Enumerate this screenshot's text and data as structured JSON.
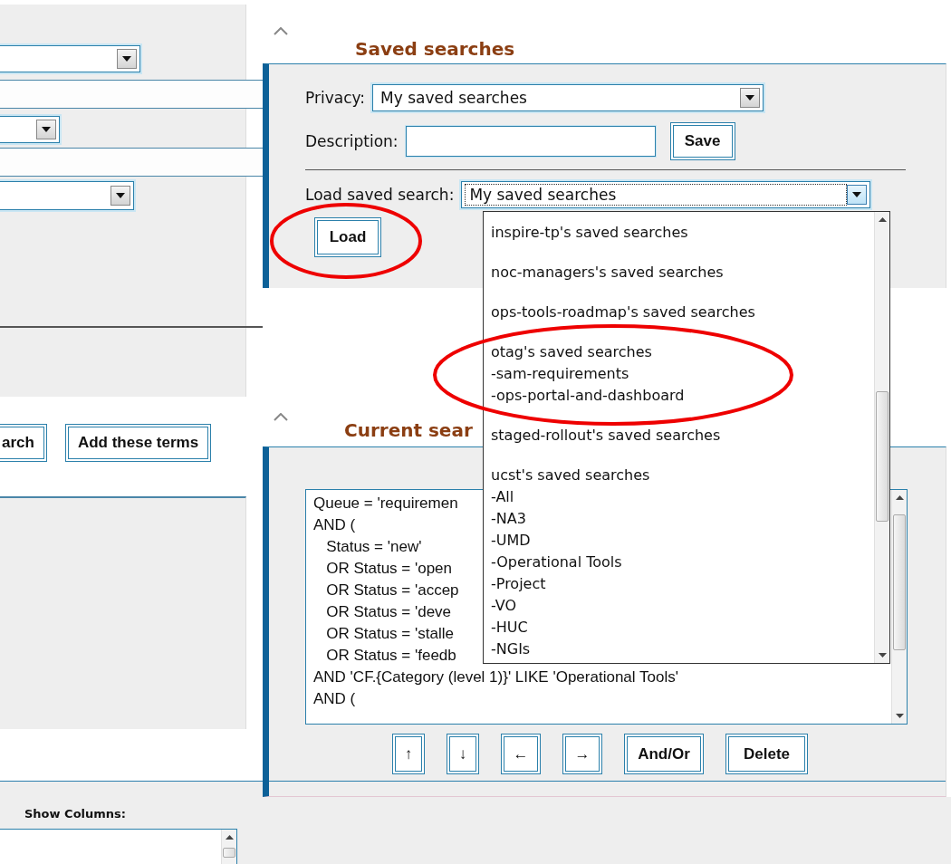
{
  "search_form": {
    "fields": [
      {
        "kind": "select"
      },
      {
        "kind": "text"
      },
      {
        "kind": "select"
      },
      {
        "kind": "text"
      },
      {
        "kind": "select"
      }
    ],
    "buttons": [
      "arch",
      "Add these terms"
    ]
  },
  "show_columns": {
    "label": "Show Columns:"
  },
  "saved_searches": {
    "title": "Saved searches",
    "privacy_label": "Privacy:",
    "privacy_value": "My saved searches",
    "description_label": "Description:",
    "save_button": "Save",
    "load_label": "Load saved search:",
    "load_value": "My saved searches",
    "load_expanded": true,
    "load_button": "Load",
    "options": [
      {
        "label": "inspire-tp's saved searches",
        "selected": false
      },
      {
        "label": "noc-managers's saved searches",
        "selected": false
      },
      {
        "label": "ops-tools-roadmap's saved searches",
        "selected": false
      },
      {
        "label": "otag's saved searches",
        "selected": false,
        "children": [
          {
            "label": "-sam-requirements",
            "selected": false
          },
          {
            "label": "-ops-portal-and-dashboard",
            "selected": false
          }
        ]
      },
      {
        "label": "staged-rollout's saved searches",
        "selected": false
      },
      {
        "label": "ucst's saved searches",
        "selected": false,
        "children": [
          {
            "label": "-All",
            "selected": false
          },
          {
            "label": "-NA3",
            "selected": false
          },
          {
            "label": "-UMD",
            "selected": false
          },
          {
            "label": "-Operational Tools",
            "selected": false
          },
          {
            "label": "-Project",
            "selected": false
          },
          {
            "label": "-VO",
            "selected": false
          },
          {
            "label": "-HUC",
            "selected": false
          },
          {
            "label": "-NGIs",
            "selected": false
          }
        ]
      }
    ]
  },
  "current_search": {
    "title": "Current sear",
    "query_lines": [
      "Queue = 'requiremen",
      "AND (",
      "   Status = 'new'",
      "   OR Status = 'open",
      "   OR Status = 'accep",
      "   OR Status = 'deve",
      "   OR Status = 'stalle",
      "   OR Status = 'feedb",
      "AND 'CF.{Category (level 1)}' LIKE 'Operational Tools'",
      "AND ("
    ],
    "buttons": [
      "↑",
      "↓",
      "←",
      "→",
      "And/Or",
      "Delete"
    ]
  },
  "annotations": [
    {
      "kind": "ellipse"
    },
    {
      "kind": "ellipse"
    }
  ]
}
